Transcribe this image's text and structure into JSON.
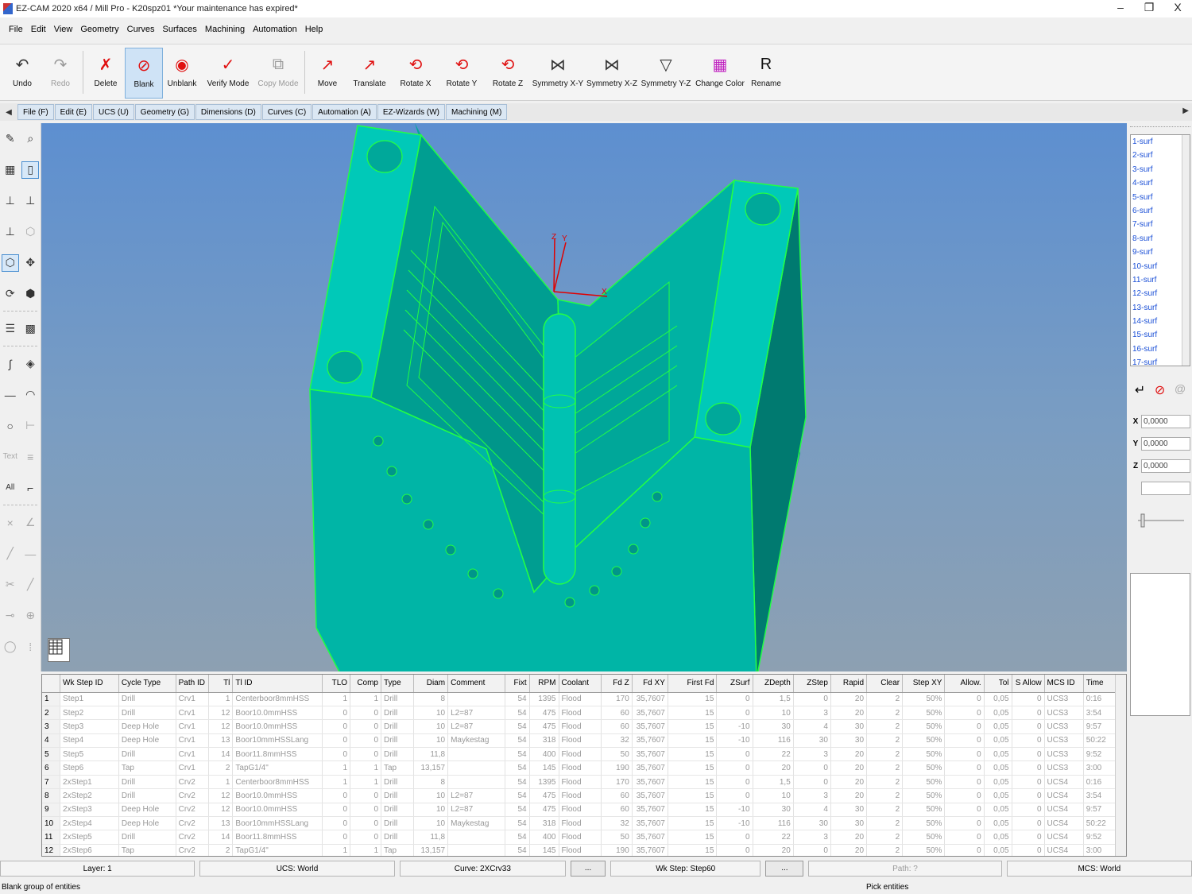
{
  "window": {
    "title": "EZ-CAM 2020 x64 / Mill Pro  - K20spz01   *Your maintenance has expired*",
    "minimize": "–",
    "restore": "❐",
    "close": "X"
  },
  "menu": [
    "File",
    "Edit",
    "View",
    "Geometry",
    "Curves",
    "Surfaces",
    "Machining",
    "Automation",
    "Help"
  ],
  "toolbar": [
    {
      "label": "Undo",
      "icon": "undo-icon",
      "glyph": "↶",
      "color": "#333333"
    },
    {
      "label": "Redo",
      "icon": "redo-icon",
      "glyph": "↷",
      "color": "#9a9a9a"
    },
    {
      "label": "Delete",
      "icon": "delete-icon",
      "glyph": "✗",
      "color": "#e01010"
    },
    {
      "label": "Blank",
      "icon": "blank-icon",
      "glyph": "⊘",
      "color": "#e01010"
    },
    {
      "label": "Unblank",
      "icon": "eye-icon",
      "glyph": "◉",
      "color": "#e01010"
    },
    {
      "label": "Verify Mode",
      "icon": "checkmark-icon",
      "glyph": "✓",
      "color": "#e01010"
    },
    {
      "label": "Copy Mode",
      "icon": "copy-icon",
      "glyph": "⧉",
      "color": "#9a9a9a"
    },
    {
      "label": "Move",
      "icon": "move-icon",
      "glyph": "↗",
      "color": "#e01010"
    },
    {
      "label": "Translate",
      "icon": "translate-icon",
      "glyph": "↗",
      "color": "#e01010"
    },
    {
      "label": "Rotate X",
      "icon": "rotate-x-icon",
      "glyph": "⟲",
      "color": "#e01010"
    },
    {
      "label": "Rotate Y",
      "icon": "rotate-y-icon",
      "glyph": "⟲",
      "color": "#e01010"
    },
    {
      "label": "Rotate Z",
      "icon": "rotate-z-icon",
      "glyph": "⟲",
      "color": "#e01010"
    },
    {
      "label": "Symmetry X-Y",
      "icon": "symmetry-xy-icon",
      "glyph": "⋈",
      "color": "#333333"
    },
    {
      "label": "Symmetry X-Z",
      "icon": "symmetry-xz-icon",
      "glyph": "⋈",
      "color": "#333333"
    },
    {
      "label": "Symmetry Y-Z",
      "icon": "symmetry-yz-icon",
      "glyph": "▽",
      "color": "#333333"
    },
    {
      "label": "Change Color",
      "icon": "color-palette-icon",
      "glyph": "▦",
      "color": "#c020c0"
    },
    {
      "label": "Rename",
      "icon": "rename-icon",
      "glyph": "R",
      "color": "#111111"
    }
  ],
  "tabs": [
    "File (F)",
    "Edit (E)",
    "UCS (U)",
    "Geometry (G)",
    "Dimensions (D)",
    "Curves (C)",
    "Automation (A)",
    "EZ-Wizards (W)",
    "Machining (M)"
  ],
  "left_palette_text": {
    "text": "Text",
    "all": "All"
  },
  "surf_list": [
    "1-surf",
    "2-surf",
    "3-surf",
    "4-surf",
    "5-surf",
    "6-surf",
    "7-surf",
    "8-surf",
    "9-surf",
    "10-surf",
    "11-surf",
    "12-surf",
    "13-surf",
    "14-surf",
    "15-surf",
    "16-surf",
    "17-surf"
  ],
  "coords": {
    "x_label": "X",
    "x": "0,0000",
    "y_label": "Y",
    "y": "0,0000",
    "z_label": "Z",
    "z": "0,0000"
  },
  "axes": {
    "x": "X",
    "y": "Y",
    "z": "Z"
  },
  "colors": {
    "part": "#00b3a4",
    "edges": "#22ff44",
    "axis": "#e00000"
  },
  "table": {
    "columns": [
      "Wk Step ID",
      "Cycle Type",
      "Path ID",
      "Tl",
      "Tl ID",
      "TLO",
      "Comp",
      "Type",
      "Diam",
      "Comment",
      "Fixt",
      "RPM",
      "Coolant",
      "Fd Z",
      "Fd XY",
      "First Fd",
      "ZSurf",
      "ZDepth",
      "ZStep",
      "Rapid",
      "Clear",
      "Step XY",
      "Allow.",
      "Tol",
      "S Allow",
      "MCS ID",
      "Time"
    ],
    "rows": [
      [
        "1",
        "Step1",
        "Drill",
        "Crv1",
        "1",
        "Centerboor8mmHSS",
        "1",
        "1",
        "Drill",
        "8",
        "",
        "54",
        "1395",
        "Flood",
        "170",
        "35,7607",
        "15",
        "0",
        "1,5",
        "0",
        "20",
        "2",
        "50%",
        "0",
        "0,05",
        "0",
        "UCS3",
        "0:16"
      ],
      [
        "2",
        "Step2",
        "Drill",
        "Crv1",
        "12",
        "Boor10.0mmHSS",
        "0",
        "0",
        "Drill",
        "10",
        "L2=87",
        "54",
        "475",
        "Flood",
        "60",
        "35,7607",
        "15",
        "0",
        "10",
        "3",
        "20",
        "2",
        "50%",
        "0",
        "0,05",
        "0",
        "UCS3",
        "3:54"
      ],
      [
        "3",
        "Step3",
        "Deep Hole",
        "Crv1",
        "12",
        "Boor10.0mmHSS",
        "0",
        "0",
        "Drill",
        "10",
        "L2=87",
        "54",
        "475",
        "Flood",
        "60",
        "35,7607",
        "15",
        "-10",
        "30",
        "4",
        "30",
        "2",
        "50%",
        "0",
        "0,05",
        "0",
        "UCS3",
        "9:57"
      ],
      [
        "4",
        "Step4",
        "Deep Hole",
        "Crv1",
        "13",
        "Boor10mmHSSLang",
        "0",
        "0",
        "Drill",
        "10",
        "Maykestag",
        "54",
        "318",
        "Flood",
        "32",
        "35,7607",
        "15",
        "-10",
        "116",
        "30",
        "30",
        "2",
        "50%",
        "0",
        "0,05",
        "0",
        "UCS3",
        "50:22"
      ],
      [
        "5",
        "Step5",
        "Drill",
        "Crv1",
        "14",
        "Boor11.8mmHSS",
        "0",
        "0",
        "Drill",
        "11,8",
        "",
        "54",
        "400",
        "Flood",
        "50",
        "35,7607",
        "15",
        "0",
        "22",
        "3",
        "20",
        "2",
        "50%",
        "0",
        "0,05",
        "0",
        "UCS3",
        "9:52"
      ],
      [
        "6",
        "Step6",
        "Tap",
        "Crv1",
        "2",
        "TapG1/4\"",
        "1",
        "1",
        "Tap",
        "13,157",
        "",
        "54",
        "145",
        "Flood",
        "190",
        "35,7607",
        "15",
        "0",
        "20",
        "0",
        "20",
        "2",
        "50%",
        "0",
        "0,05",
        "0",
        "UCS3",
        "3:00"
      ],
      [
        "7",
        "2xStep1",
        "Drill",
        "Crv2",
        "1",
        "Centerboor8mmHSS",
        "1",
        "1",
        "Drill",
        "8",
        "",
        "54",
        "1395",
        "Flood",
        "170",
        "35,7607",
        "15",
        "0",
        "1,5",
        "0",
        "20",
        "2",
        "50%",
        "0",
        "0,05",
        "0",
        "UCS4",
        "0:16"
      ],
      [
        "8",
        "2xStep2",
        "Drill",
        "Crv2",
        "12",
        "Boor10.0mmHSS",
        "0",
        "0",
        "Drill",
        "10",
        "L2=87",
        "54",
        "475",
        "Flood",
        "60",
        "35,7607",
        "15",
        "0",
        "10",
        "3",
        "20",
        "2",
        "50%",
        "0",
        "0,05",
        "0",
        "UCS4",
        "3:54"
      ],
      [
        "9",
        "2xStep3",
        "Deep Hole",
        "Crv2",
        "12",
        "Boor10.0mmHSS",
        "0",
        "0",
        "Drill",
        "10",
        "L2=87",
        "54",
        "475",
        "Flood",
        "60",
        "35,7607",
        "15",
        "-10",
        "30",
        "4",
        "30",
        "2",
        "50%",
        "0",
        "0,05",
        "0",
        "UCS4",
        "9:57"
      ],
      [
        "10",
        "2xStep4",
        "Deep Hole",
        "Crv2",
        "13",
        "Boor10mmHSSLang",
        "0",
        "0",
        "Drill",
        "10",
        "Maykestag",
        "54",
        "318",
        "Flood",
        "32",
        "35,7607",
        "15",
        "-10",
        "116",
        "30",
        "30",
        "2",
        "50%",
        "0",
        "0,05",
        "0",
        "UCS4",
        "50:22"
      ],
      [
        "11",
        "2xStep5",
        "Drill",
        "Crv2",
        "14",
        "Boor11.8mmHSS",
        "0",
        "0",
        "Drill",
        "11,8",
        "",
        "54",
        "400",
        "Flood",
        "50",
        "35,7607",
        "15",
        "0",
        "22",
        "3",
        "20",
        "2",
        "50%",
        "0",
        "0,05",
        "0",
        "UCS4",
        "9:52"
      ],
      [
        "12",
        "2xStep6",
        "Tap",
        "Crv2",
        "2",
        "TapG1/4\"",
        "1",
        "1",
        "Tap",
        "13,157",
        "",
        "54",
        "145",
        "Flood",
        "190",
        "35,7607",
        "15",
        "0",
        "20",
        "0",
        "20",
        "2",
        "50%",
        "0",
        "0,05",
        "0",
        "UCS4",
        "3:00"
      ]
    ]
  },
  "status": {
    "layer": "Layer: 1",
    "ucs": "UCS: World",
    "curve": "Curve: 2XCrv33",
    "curve_btn": "...",
    "wkstep": "Wk Step: Step60",
    "wkstep_btn": "...",
    "path": "Path: ?",
    "mcs": "MCS: World"
  },
  "bottom": {
    "left": "Blank group of entities",
    "right": "Pick entities"
  }
}
